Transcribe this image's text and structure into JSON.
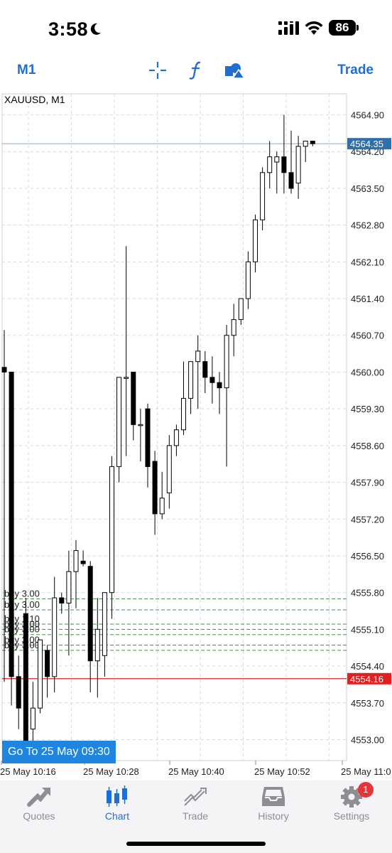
{
  "status": {
    "time": "3:58",
    "battery": "86"
  },
  "toolbar": {
    "period": "M1",
    "trade": "Trade"
  },
  "chart": {
    "symbol_label": "XAUUSD, M1",
    "goto_label": "Go To 25 May 09:30",
    "current_price": "4564.35",
    "order_price": "4554.16",
    "price_ticks": [
      "4564.90",
      "4564.20",
      "4563.50",
      "4562.80",
      "4562.10",
      "4561.40",
      "4560.70",
      "4560.00",
      "4559.30",
      "4558.60",
      "4557.90",
      "4557.20",
      "4556.50",
      "4555.80",
      "4555.10",
      "4554.40",
      "4553.70",
      "4553.00"
    ],
    "time_ticks": [
      "25 May 10:16",
      "25 May 10:28",
      "25 May 10:40",
      "25 May 10:52",
      "25 May 11:0"
    ],
    "order_labels": [
      "buy 3.00",
      "buy 3.00",
      "buy 1.10",
      "buy 3.00",
      "buy 3.00",
      "buy 3.00",
      "buy 3.00"
    ],
    "colors": {
      "bid_line": "#8fa9bf",
      "order_line": "#e02020",
      "bid_label_bg": "#2e6fae",
      "order_label_bg": "#e02020",
      "pending_line": "#3a9b3a"
    }
  },
  "chart_data": {
    "type": "candlestick",
    "symbol": "XAUUSD",
    "timeframe": "M1",
    "ylim": [
      4552.6,
      4565.3
    ],
    "candles": [
      {
        "o": 4560.09,
        "h": 4560.8,
        "l": 4554.1,
        "c": 4560.0
      },
      {
        "o": 4560.0,
        "h": 4560.0,
        "l": 4553.65,
        "c": 4554.2
      },
      {
        "o": 4554.2,
        "h": 4554.6,
        "l": 4553.2,
        "c": 4553.6
      },
      {
        "o": 4555.4,
        "h": 4555.7,
        "l": 4552.9,
        "c": 4552.93
      },
      {
        "o": 4553.2,
        "h": 4554.1,
        "l": 4552.8,
        "c": 4553.6
      },
      {
        "o": 4553.6,
        "h": 4554.9,
        "l": 4553.5,
        "c": 4554.9
      },
      {
        "o": 4554.7,
        "h": 4554.8,
        "l": 4553.8,
        "c": 4554.2
      },
      {
        "o": 4554.2,
        "h": 4556.1,
        "l": 4553.9,
        "c": 4555.7
      },
      {
        "o": 4555.7,
        "h": 4555.8,
        "l": 4555.4,
        "c": 4555.6
      },
      {
        "o": 4555.6,
        "h": 4556.6,
        "l": 4554.6,
        "c": 4556.2
      },
      {
        "o": 4556.2,
        "h": 4556.8,
        "l": 4555.5,
        "c": 4556.6
      },
      {
        "o": 4556.4,
        "h": 4556.6,
        "l": 4556.3,
        "c": 4556.35
      },
      {
        "o": 4556.3,
        "h": 4556.4,
        "l": 4553.9,
        "c": 4554.5
      },
      {
        "o": 4554.5,
        "h": 4555.7,
        "l": 4553.8,
        "c": 4555.1
      },
      {
        "o": 4554.6,
        "h": 4555.8,
        "l": 4554.2,
        "c": 4555.8
      },
      {
        "o": 4555.8,
        "h": 4558.4,
        "l": 4555.3,
        "c": 4558.2
      },
      {
        "o": 4558.2,
        "h": 4559.9,
        "l": 4557.9,
        "c": 4559.9
      },
      {
        "o": 4559.9,
        "h": 4562.4,
        "l": 4558.4,
        "c": 4559.9
      },
      {
        "o": 4560.0,
        "h": 4560.0,
        "l": 4558.7,
        "c": 4559.0
      },
      {
        "o": 4559.0,
        "h": 4559.3,
        "l": 4558.3,
        "c": 4559.0
      },
      {
        "o": 4559.3,
        "h": 4559.4,
        "l": 4557.8,
        "c": 4558.2
      },
      {
        "o": 4558.3,
        "h": 4558.5,
        "l": 4556.9,
        "c": 4557.3
      },
      {
        "o": 4557.3,
        "h": 4558.1,
        "l": 4557.2,
        "c": 4557.6
      },
      {
        "o": 4557.7,
        "h": 4558.8,
        "l": 4557.4,
        "c": 4558.6
      },
      {
        "o": 4558.6,
        "h": 4559.0,
        "l": 4558.4,
        "c": 4558.9
      },
      {
        "o": 4558.9,
        "h": 4560.2,
        "l": 4558.8,
        "c": 4559.5
      },
      {
        "o": 4559.5,
        "h": 4560.2,
        "l": 4559.2,
        "c": 4560.2
      },
      {
        "o": 4560.2,
        "h": 4560.7,
        "l": 4559.3,
        "c": 4560.4
      },
      {
        "o": 4560.2,
        "h": 4560.4,
        "l": 4559.6,
        "c": 4559.9
      },
      {
        "o": 4559.9,
        "h": 4560.3,
        "l": 4559.4,
        "c": 4559.8
      },
      {
        "o": 4559.8,
        "h": 4560.0,
        "l": 4559.2,
        "c": 4559.7
      },
      {
        "o": 4559.7,
        "h": 4560.9,
        "l": 4558.2,
        "c": 4560.7
      },
      {
        "o": 4560.7,
        "h": 4561.3,
        "l": 4560.3,
        "c": 4561.0
      },
      {
        "o": 4561.0,
        "h": 4561.4,
        "l": 4560.9,
        "c": 4561.4
      },
      {
        "o": 4561.4,
        "h": 4562.3,
        "l": 4561.2,
        "c": 4562.1
      },
      {
        "o": 4562.1,
        "h": 4563.0,
        "l": 4561.9,
        "c": 4562.9
      },
      {
        "o": 4562.9,
        "h": 4563.9,
        "l": 4562.7,
        "c": 4563.8
      },
      {
        "o": 4563.8,
        "h": 4564.4,
        "l": 4563.5,
        "c": 4564.1
      },
      {
        "o": 4564.0,
        "h": 4564.2,
        "l": 4563.4,
        "c": 4564.1
      },
      {
        "o": 4564.1,
        "h": 4564.9,
        "l": 4563.4,
        "c": 4563.8
      },
      {
        "o": 4563.8,
        "h": 4564.6,
        "l": 4563.4,
        "c": 4563.5
      },
      {
        "o": 4563.6,
        "h": 4564.5,
        "l": 4563.3,
        "c": 4564.3
      },
      {
        "o": 4564.3,
        "h": 4564.4,
        "l": 4564.0,
        "c": 4564.4
      },
      {
        "o": 4564.4,
        "h": 4564.4,
        "l": 4564.3,
        "c": 4564.35
      }
    ],
    "bid": 4564.35,
    "order_line": 4554.16,
    "pending_orders": [
      4555.68,
      4555.47,
      4555.2,
      4555.1,
      4555.0,
      4554.8,
      4554.7
    ],
    "y_ticks": [
      4564.9,
      4564.2,
      4563.5,
      4562.8,
      4562.1,
      4561.4,
      4560.7,
      4560.0,
      4559.3,
      4558.6,
      4557.9,
      4557.2,
      4556.5,
      4555.8,
      4555.1,
      4554.4,
      4553.7,
      4553.0
    ],
    "x_ticks": [
      "25 May 10:16",
      "25 May 10:28",
      "25 May 10:40",
      "25 May 10:52",
      "25 May 11:0"
    ],
    "grid": true
  },
  "tabs": [
    {
      "label": "Quotes",
      "icon": "quotes-icon",
      "active": false
    },
    {
      "label": "Chart",
      "icon": "chart-icon",
      "active": true
    },
    {
      "label": "Trade",
      "icon": "trade-icon",
      "active": false
    },
    {
      "label": "History",
      "icon": "history-icon",
      "active": false
    },
    {
      "label": "Settings",
      "icon": "settings-icon",
      "active": false,
      "badge": "1"
    }
  ]
}
